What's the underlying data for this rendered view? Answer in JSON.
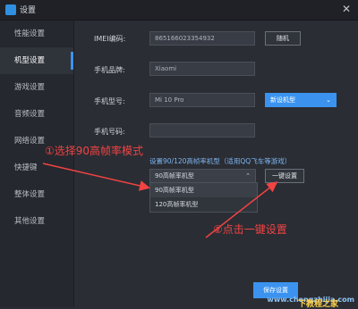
{
  "window": {
    "title": "设置",
    "close_icon": "close-icon"
  },
  "sidebar": {
    "items": [
      {
        "label": "性能设置"
      },
      {
        "label": "机型设置"
      },
      {
        "label": "游戏设置"
      },
      {
        "label": "音频设置"
      },
      {
        "label": "网络设置"
      },
      {
        "label": "快捷键"
      },
      {
        "label": "整体设置"
      },
      {
        "label": "其他设置"
      }
    ],
    "active_index": 1
  },
  "form": {
    "imei_label": "IMEI编码:",
    "imei_value": "865166023354932",
    "random_button": "随机",
    "brand_label": "手机品牌:",
    "brand_value": "Xiaomi",
    "model_label": "手机型号:",
    "model_value": "Mi 10 Pro",
    "model_type_value": "新设机型",
    "phone_label": "手机号码:",
    "phone_value": "",
    "hz_hint": "设置90/120高帧率机型（适用QQ飞车等游戏）",
    "hz_select_value": "90高帧率机型",
    "hz_options": [
      "90高帧率机型",
      "120高帧率机型"
    ],
    "one_key_button": "一键设置",
    "save_button": "保存设置"
  },
  "annotations": {
    "step1": "①选择90高帧率模式",
    "step2": "②点击一键设置"
  },
  "watermark": {
    "url_text": "www.chengzhijia.com",
    "brand": "下教程之家"
  },
  "colors": {
    "accent": "#3b93ef",
    "annotation": "#f24343"
  }
}
